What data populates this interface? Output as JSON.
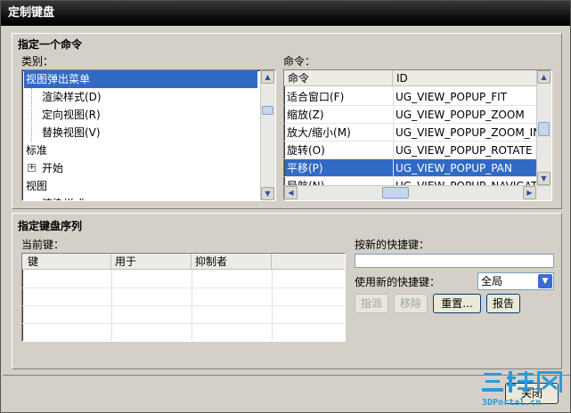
{
  "window": {
    "title": "定制键盘"
  },
  "specify_command": {
    "title": "指定一个命令",
    "category_label": "类别：",
    "command_label": "命令：",
    "categories": [
      {
        "label": "视图弹出菜单",
        "selected": true
      },
      {
        "label": "渲染样式(D)"
      },
      {
        "label": "定向视图(R)"
      },
      {
        "label": "替换视图(V)"
      },
      {
        "label": "标准"
      },
      {
        "label": "开始"
      },
      {
        "label": "视图"
      },
      {
        "label": "渲染样式"
      }
    ],
    "command_columns": [
      "命令",
      "ID"
    ],
    "commands": [
      {
        "name": "适合窗口(F)",
        "id": "UG_VIEW_POPUP_FIT"
      },
      {
        "name": "缩放(Z)",
        "id": "UG_VIEW_POPUP_ZOOM"
      },
      {
        "name": "放大/缩小(M)",
        "id": "UG_VIEW_POPUP_ZOOM_IN..."
      },
      {
        "name": "旋转(O)",
        "id": "UG_VIEW_POPUP_ROTATE"
      },
      {
        "name": "平移(P)",
        "id": "UG_VIEW_POPUP_PAN",
        "selected": true
      },
      {
        "name": "导航(N)",
        "id": "UG_VIEW_POPUP_NAVIGAT"
      }
    ]
  },
  "key_sequence": {
    "title": "指定键盘序列",
    "current_keys_label": "当前键：",
    "columns": [
      "键",
      "用于",
      "抑制者"
    ],
    "new_shortcut_label": "按新的快捷键：",
    "new_shortcut_value": "",
    "use_shortcut_label": "使用新的快捷键：",
    "scope_value": "全局",
    "assign_label": "指派",
    "remove_label": "移除",
    "reset_label": "重置...",
    "report_label": "报告"
  },
  "footer": {
    "close_label": "关闭"
  },
  "watermark": {
    "text_main": "三维网",
    "text_sub": "3DPortal.cn"
  },
  "colors": {
    "selection": "#316ac5",
    "titlebar": "#000000",
    "dialog_bg": "#d4d0c8"
  }
}
